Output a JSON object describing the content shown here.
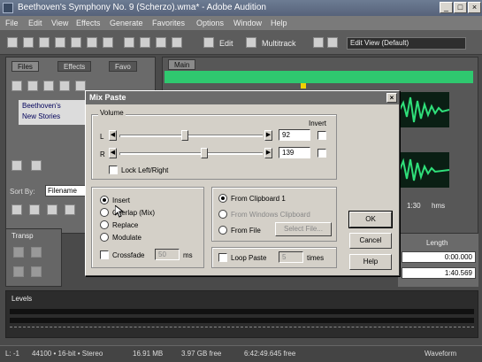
{
  "window": {
    "title": "Beethoven's Symphony No. 9 (Scherzo).wma* - Adobe Audition",
    "controls": [
      "_",
      "□",
      "×"
    ]
  },
  "menu": [
    "File",
    "Edit",
    "View",
    "Effects",
    "Generate",
    "Favorites",
    "Options",
    "Window",
    "Help"
  ],
  "toolbar": {
    "edit_label": "Edit",
    "multitrack_label": "Multitrack",
    "view_select": "Edit View (Default)"
  },
  "left_panel": {
    "tabs": [
      "Files",
      "Effects",
      "Favo"
    ],
    "files": [
      "Beethoven's",
      "New Stories"
    ],
    "sort_label": "Sort By:",
    "sort_value": "Filename"
  },
  "main_panel": {
    "tab": "Main",
    "time_label": "1:30",
    "time_unit": "hms"
  },
  "transport": {
    "title": "Transp"
  },
  "length_panel": {
    "header": "Length",
    "values": [
      "0:00.000",
      "1:40.569"
    ]
  },
  "levels": {
    "title": "Levels"
  },
  "status": {
    "channel": "L: -1",
    "format": "44100 • 16-bit • Stereo",
    "size": "16.91 MB",
    "free": "3.97 GB free",
    "time_free": "6:42:49.645 free",
    "view": "Waveform"
  },
  "dialog": {
    "title": "Mix Paste",
    "close": "×",
    "volume_label": "Volume",
    "invert_label": "Invert",
    "left_label": "L",
    "right_label": "R",
    "left_value": "92",
    "right_value": "139",
    "lock_label": "Lock Left/Right",
    "mode_options": [
      "Insert",
      "Overlap (Mix)",
      "Replace",
      "Modulate"
    ],
    "mode_selected": 0,
    "crossfade_label": "Crossfade",
    "crossfade_value": "50",
    "crossfade_unit": "ms",
    "source_options": [
      "From Clipboard 1",
      "From Windows Clipboard",
      "From File"
    ],
    "select_file_label": "Select File...",
    "loop_label": "Loop Paste",
    "loop_value": "5",
    "loop_unit": "times",
    "ok_label": "OK",
    "cancel_label": "Cancel",
    "help_label": "Help"
  }
}
